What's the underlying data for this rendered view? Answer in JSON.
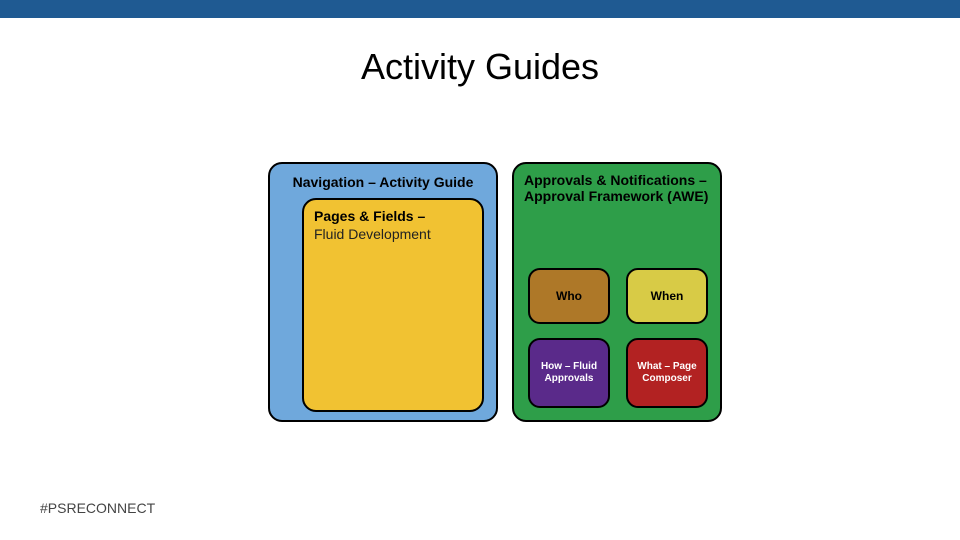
{
  "title": "Activity Guides",
  "hashtag": "#PSRECONNECT",
  "nav": {
    "label": "Navigation – Activity Guide"
  },
  "pages": {
    "label_bold": "Pages & Fields –",
    "label_reg": "Fluid Development"
  },
  "approvals": {
    "label": "Approvals & Notifications – Approval Framework (AWE)",
    "who": "Who",
    "when": "When",
    "how": "How – Fluid Approvals",
    "what": "What – Page Composer"
  },
  "colors": {
    "topbar": "#1f5a92",
    "nav": "#6fa8dc",
    "pages": "#f1c232",
    "approvals": "#2e9e49",
    "who": "#ae7828",
    "when": "#d8cb46",
    "how": "#5a2a8a",
    "what": "#b22222"
  }
}
